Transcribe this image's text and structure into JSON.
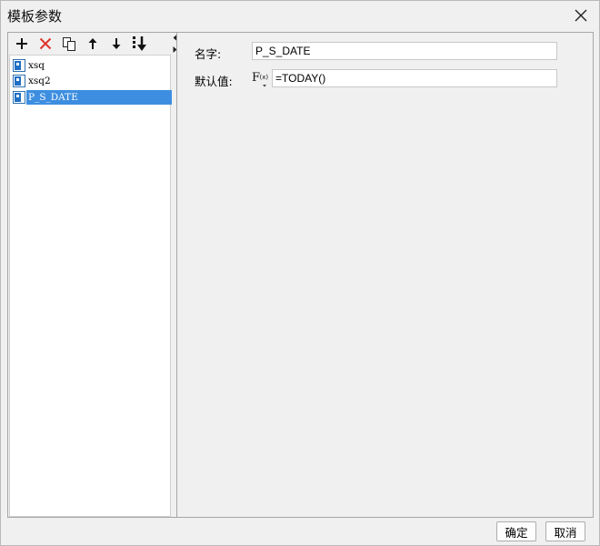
{
  "dialog": {
    "title": "模板参数",
    "close_icon": "close-icon"
  },
  "toolbar": {
    "buttons": [
      {
        "name": "add-parameter-button",
        "icon": "plus-icon"
      },
      {
        "name": "delete-parameter-button",
        "icon": "x-icon",
        "color": "#e0332b"
      },
      {
        "name": "copy-parameter-button",
        "icon": "copy-icon"
      },
      {
        "name": "move-up-button",
        "icon": "arrow-up-icon"
      },
      {
        "name": "move-down-button",
        "icon": "arrow-down-icon"
      },
      {
        "name": "import-button",
        "icon": "import-down-icon"
      }
    ]
  },
  "tree": {
    "items": [
      {
        "label": "xsq",
        "selected": false
      },
      {
        "label": "xsq2",
        "selected": false
      },
      {
        "label": "P_S_DATE",
        "selected": true
      }
    ],
    "selection_color": "#3d8ee0"
  },
  "form": {
    "name_label": "名字:",
    "name_value": "P_S_DATE",
    "default_label": "默认值:",
    "default_value": "=TODAY()",
    "fx_icon": "formula-fx-icon"
  },
  "footer": {
    "ok_label": "确定",
    "cancel_label": "取消"
  }
}
